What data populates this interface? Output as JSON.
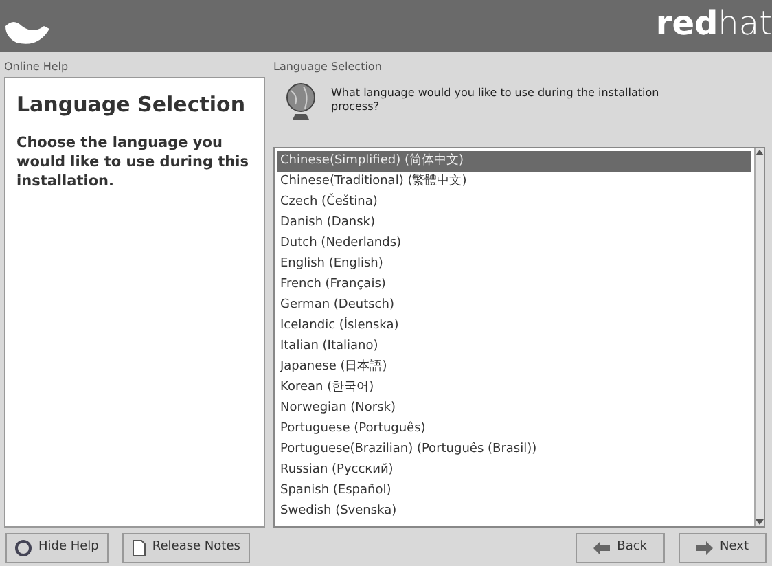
{
  "header": {
    "brand": "**red**hat"
  },
  "help_panel": {
    "label": "Online Help",
    "title": "Language Selection",
    "text": "Choose the language you would like to use during this installation."
  },
  "main": {
    "label": "Language Selection",
    "question": "What language would you like to use during the installation process?",
    "languages": [
      {
        "name": "Chinese(Simplified) (简体中文)",
        "selected": true
      },
      {
        "name": "Chinese(Traditional) (繁體中文)",
        "selected": false
      },
      {
        "name": "Czech (Čeština)",
        "selected": false
      },
      {
        "name": "Danish (Dansk)",
        "selected": false
      },
      {
        "name": "Dutch (Nederlands)",
        "selected": false
      },
      {
        "name": "English (English)",
        "selected": false
      },
      {
        "name": "French (Français)",
        "selected": false
      },
      {
        "name": "German (Deutsch)",
        "selected": false
      },
      {
        "name": "Icelandic (Íslenska)",
        "selected": false
      },
      {
        "name": "Italian (Italiano)",
        "selected": false
      },
      {
        "name": "Japanese (日本語)",
        "selected": false
      },
      {
        "name": "Korean (한국어)",
        "selected": false
      },
      {
        "name": "Norwegian (Norsk)",
        "selected": false
      },
      {
        "name": "Portuguese (Português)",
        "selected": false
      },
      {
        "name": "Portuguese(Brazilian) (Português (Brasil))",
        "selected": false
      },
      {
        "name": "Russian (Русский)",
        "selected": false
      },
      {
        "name": "Spanish (Español)",
        "selected": false
      },
      {
        "name": "Swedish (Svenska)",
        "selected": false
      }
    ]
  },
  "buttons": [
    {
      "kind": "help",
      "label": "Hide Help"
    },
    {
      "kind": "notes",
      "label": "Release Notes"
    },
    {
      "kind": "back",
      "label": "Back"
    },
    {
      "kind": "next",
      "label": "Next"
    }
  ]
}
